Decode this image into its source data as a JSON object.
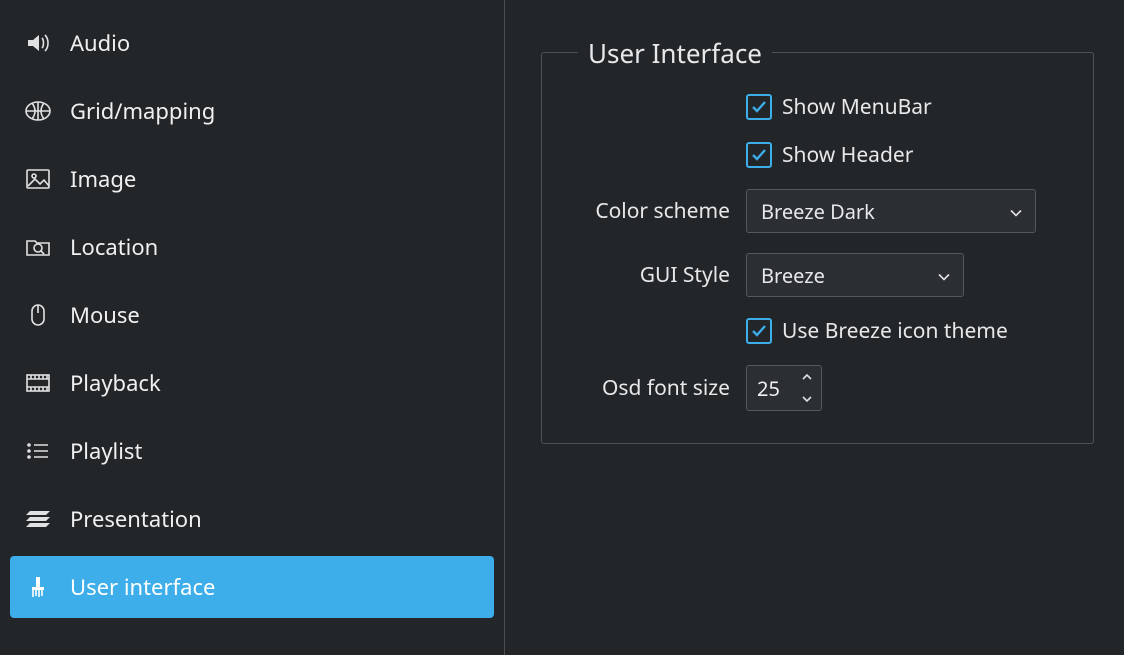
{
  "sidebar": {
    "items": [
      {
        "label": "Audio"
      },
      {
        "label": "Grid/mapping"
      },
      {
        "label": "Image"
      },
      {
        "label": "Location"
      },
      {
        "label": "Mouse"
      },
      {
        "label": "Playback"
      },
      {
        "label": "Playlist"
      },
      {
        "label": "Presentation"
      },
      {
        "label": "User interface"
      }
    ]
  },
  "panel": {
    "title": "User Interface",
    "show_menubar": {
      "label": "Show MenuBar",
      "checked": true
    },
    "show_header": {
      "label": "Show Header",
      "checked": true
    },
    "color_scheme": {
      "label": "Color scheme",
      "value": "Breeze Dark"
    },
    "gui_style": {
      "label": "GUI Style",
      "value": "Breeze"
    },
    "use_breeze_icons": {
      "label": "Use Breeze icon theme",
      "checked": true
    },
    "osd_font_size": {
      "label": "Osd font size",
      "value": "25"
    }
  }
}
